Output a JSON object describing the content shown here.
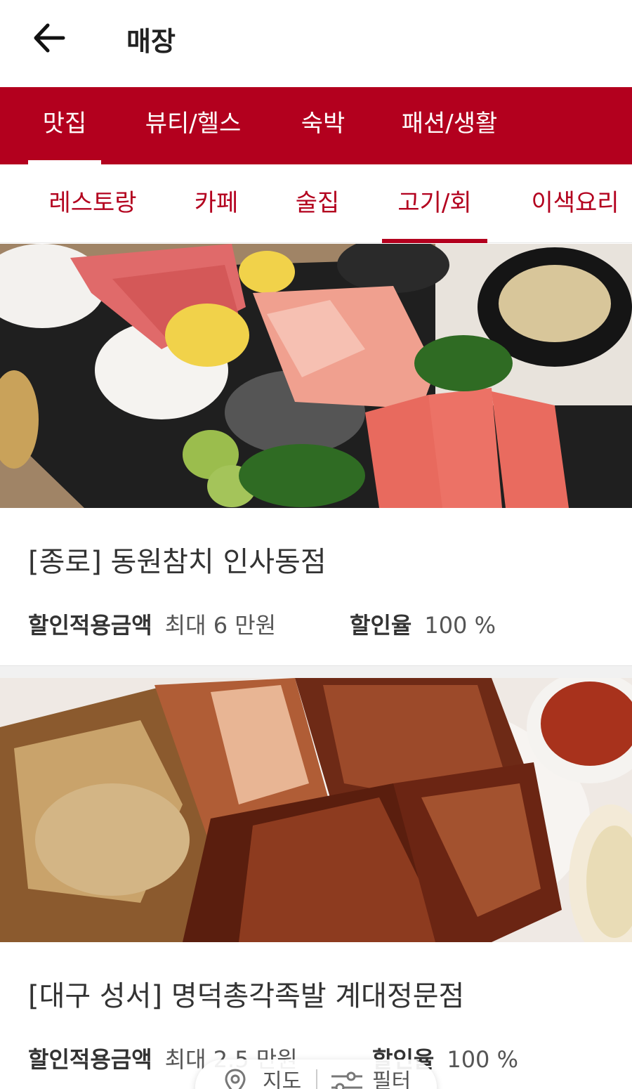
{
  "header": {
    "title": "매장"
  },
  "categories": [
    {
      "label": "맛집",
      "active": true
    },
    {
      "label": "뷰티/헬스",
      "active": false
    },
    {
      "label": "숙박",
      "active": false
    },
    {
      "label": "패션/생활",
      "active": false
    }
  ],
  "subcategories": [
    {
      "label": "레스토랑",
      "active": false
    },
    {
      "label": "카페",
      "active": false
    },
    {
      "label": "술집",
      "active": false
    },
    {
      "label": "고기/회",
      "active": true
    },
    {
      "label": "이색요리",
      "active": false
    }
  ],
  "stores": [
    {
      "name": "[종로] 동원참치 인사동점",
      "discount_amount_label": "할인적용금액",
      "discount_amount_value": "최대 6 만원",
      "discount_rate_label": "할인율",
      "discount_rate_value": "100 %"
    },
    {
      "name": "[대구 성서] 명덕총각족발 계대정문점",
      "discount_amount_label": "할인적용금액",
      "discount_amount_value": "최대 2.5 만원",
      "discount_rate_label": "할인율",
      "discount_rate_value": "100 %"
    }
  ],
  "floating": {
    "map_label": "지도",
    "filter_label": "필터"
  },
  "colors": {
    "brand": "#b3001e"
  }
}
